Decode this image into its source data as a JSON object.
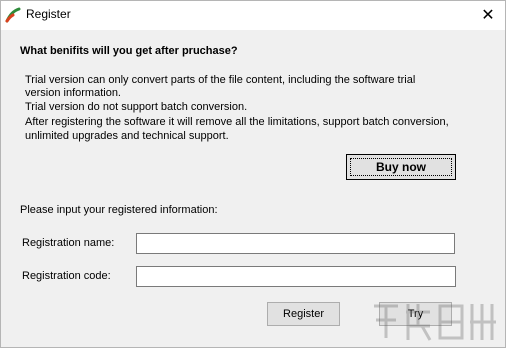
{
  "window": {
    "title": "Register",
    "close_glyph": "✕"
  },
  "benefits": {
    "heading": "What benifits will you get after pruchase?",
    "lines": [
      "Trial version can only convert parts of the file content, including the software trial",
      "version information.",
      "Trial version do not support batch conversion.",
      "After registering the software it will remove all the limitations, support batch conversion,",
      "unlimited upgrades and technical support."
    ]
  },
  "buy_button": {
    "label": "Buy now"
  },
  "registration": {
    "prompt": "Please input your registered information:",
    "name_label": "Registration name:",
    "name_value": "",
    "code_label": "Registration code:",
    "code_value": ""
  },
  "actions": {
    "register_label": "Register",
    "try_label": "Try"
  },
  "colors": {
    "window_bg": "#f0f0f0",
    "titlebar_bg": "#ffffff",
    "button_bg": "#e1e1e1"
  }
}
